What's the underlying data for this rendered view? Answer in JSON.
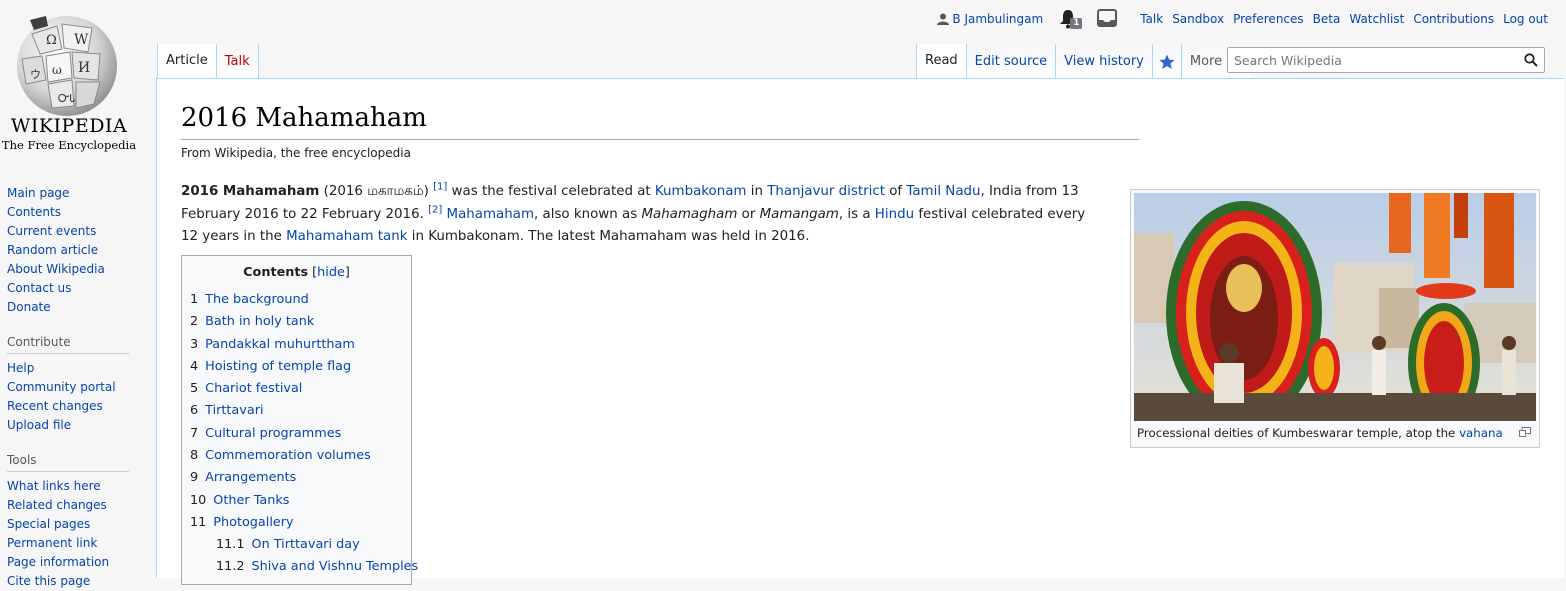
{
  "logo": {
    "wordmark": "Wikipedia",
    "tagline": "The Free Encyclopedia",
    "wordmark_display": "WIKIPEDIA"
  },
  "sidebar": {
    "navigation": [
      "Main page",
      "Contents",
      "Current events",
      "Random article",
      "About Wikipedia",
      "Contact us",
      "Donate"
    ],
    "contribute_heading": "Contribute",
    "contribute": [
      "Help",
      "Community portal",
      "Recent changes",
      "Upload file"
    ],
    "tools_heading": "Tools",
    "tools": [
      "What links here",
      "Related changes",
      "Special pages",
      "Permanent link",
      "Page information",
      "Cite this page"
    ]
  },
  "personal": {
    "username": "B Jambulingam",
    "notification_count": "1",
    "links": [
      "Talk",
      "Sandbox",
      "Preferences",
      "Beta",
      "Watchlist",
      "Contributions",
      "Log out"
    ]
  },
  "tabs": {
    "namespace": [
      "Article",
      "Talk"
    ],
    "views": [
      "Read",
      "Edit source",
      "View history"
    ],
    "more": "More"
  },
  "search": {
    "placeholder": "Search Wikipedia"
  },
  "article": {
    "title": "2016 Mahamaham",
    "tagline": "From Wikipedia, the free encyclopedia",
    "lead": {
      "bold_title": "2016 Mahamaham",
      "tamil": " (2016 மகாமகம்) ",
      "ref1": "[1]",
      "t1": " was the festival celebrated at ",
      "link_kumbakonam": "Kumbakonam",
      "t2": " in ",
      "link_thanjavur": "Thanjavur district",
      "t3": " of ",
      "link_tamilnadu": "Tamil Nadu",
      "t4": ", India from 13 February 2016 to 22 February 2016. ",
      "ref2": "[2]",
      "t5": " ",
      "link_mahamaham": "Mahamaham",
      "t6": ", also known as ",
      "i1": "Mahamagham",
      "t7": " or ",
      "i2": "Mamangam",
      "t8": ", is a ",
      "link_hindu": "Hindu",
      "t9": " festival celebrated every 12 years in the ",
      "link_tank": "Mahamaham tank",
      "t10": " in Kumbakonam. The latest Mahamaham was held in 2016."
    }
  },
  "toc": {
    "title": "Contents",
    "hide": "hide",
    "items": [
      {
        "num": "1",
        "label": "The background"
      },
      {
        "num": "2",
        "label": "Bath in holy tank"
      },
      {
        "num": "3",
        "label": "Pandakkal muhurttham"
      },
      {
        "num": "4",
        "label": "Hoisting of temple flag"
      },
      {
        "num": "5",
        "label": "Chariot festival"
      },
      {
        "num": "6",
        "label": "Tirttavari"
      },
      {
        "num": "7",
        "label": "Cultural programmes"
      },
      {
        "num": "8",
        "label": "Commemoration volumes"
      },
      {
        "num": "9",
        "label": "Arrangements"
      },
      {
        "num": "10",
        "label": "Other Tanks"
      },
      {
        "num": "11",
        "label": "Photogallery"
      }
    ],
    "subitems": [
      {
        "num": "11.1",
        "label": "On Tirttavari day"
      },
      {
        "num": "11.2",
        "label": "Shiva and Vishnu Temples"
      }
    ]
  },
  "thumb": {
    "caption": "Processional deities of Kumbeswarar temple, atop the ",
    "caption_link": "vahana"
  },
  "colors": {
    "link": "#0645ad",
    "new_link": "#ba0000",
    "tab_border": "#a7d7f9",
    "text": "#202122"
  }
}
